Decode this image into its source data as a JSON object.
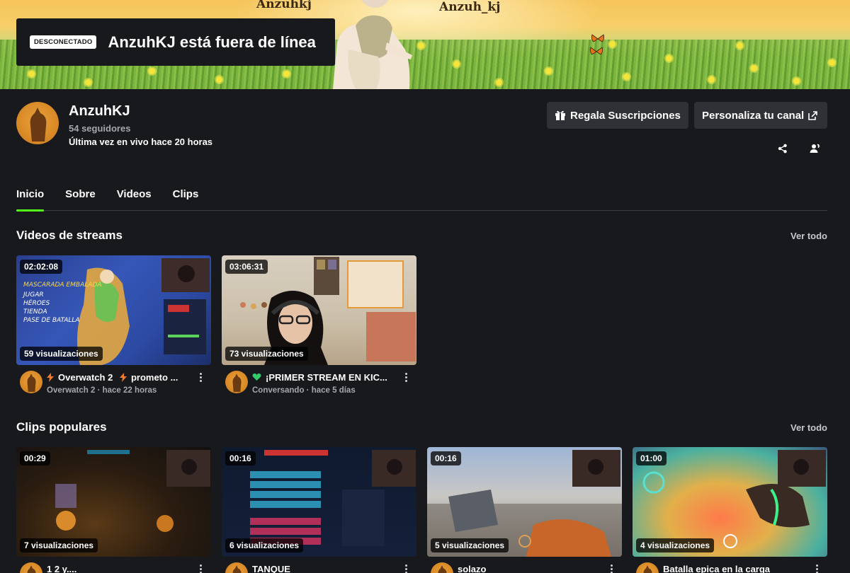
{
  "banner": {
    "label_left": "Anzuhkj",
    "label_right": "Anzuh_kj",
    "status_badge": "DESCONECTADO",
    "offline_message": "AnzuhKJ está fuera de línea"
  },
  "channel": {
    "name": "AnzuhKJ",
    "followers": "54 seguidores",
    "last_live": "Última vez en vivo hace 20 horas",
    "gift_button": "Regala Suscripciones",
    "customize_button": "Personaliza tu canal"
  },
  "tabs": [
    {
      "label": "Inicio",
      "active": true
    },
    {
      "label": "Sobre"
    },
    {
      "label": "Videos"
    },
    {
      "label": "Clips"
    }
  ],
  "streams": {
    "title": "Videos de streams",
    "see_all": "Ver todo",
    "items": [
      {
        "duration": "02:02:08",
        "views": "59 visualizaciones",
        "title_parts": [
          "Overwatch 2",
          "prometo ..."
        ],
        "subtitle": "Overwatch 2 · hace 22 horas"
      },
      {
        "duration": "03:06:31",
        "views": "73 visualizaciones",
        "title": "¡PRIMER STREAM EN KIC...",
        "subtitle": "Conversando · hace 5 días"
      }
    ]
  },
  "clips": {
    "title": "Clips populares",
    "see_all": "Ver todo",
    "items": [
      {
        "duration": "00:29",
        "views": "7 visualizaciones",
        "title": "1 2 y...."
      },
      {
        "duration": "00:16",
        "views": "6 visualizaciones",
        "title": "TANQUE"
      },
      {
        "duration": "00:16",
        "views": "5 visualizaciones",
        "title": "solazo"
      },
      {
        "duration": "01:00",
        "views": "4 visualizaciones",
        "title": "Batalla epica en la carga"
      }
    ]
  },
  "colors": {
    "background": "#18191c",
    "accent": "#53fc18",
    "button": "#2f3136",
    "muted_text": "#a3a7ae"
  },
  "icons": [
    "gift-icon",
    "external-link-icon",
    "share-icon",
    "person-settings-icon",
    "lightning-icon",
    "green-heart-icon",
    "kebab-menu-icon"
  ]
}
